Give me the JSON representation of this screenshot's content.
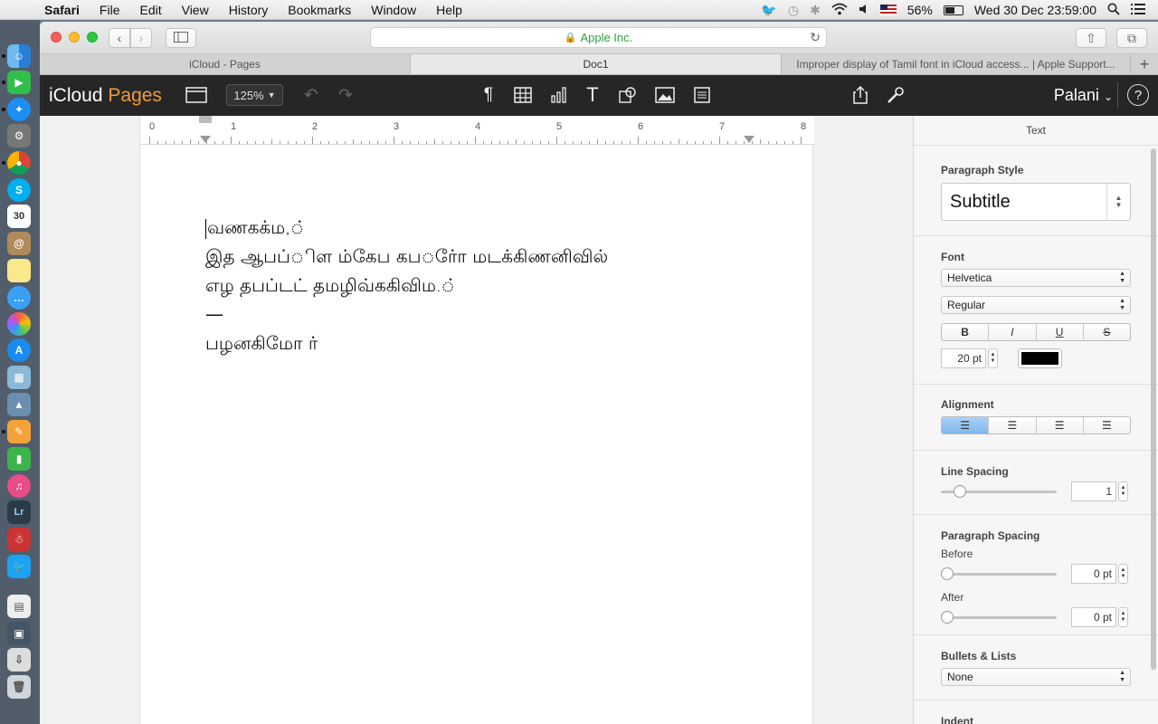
{
  "menubar": {
    "app": "Safari",
    "items": [
      "File",
      "Edit",
      "View",
      "History",
      "Bookmarks",
      "Window",
      "Help"
    ],
    "battery": "56%",
    "clock": "Wed 30 Dec  23:59:00",
    "battery_level": 0.56
  },
  "browser": {
    "address": "Apple Inc.",
    "tabs": [
      {
        "label": "iCloud - Pages"
      },
      {
        "label": "Doc1"
      },
      {
        "label": "Improper display of Tamil font in iCloud access... | Apple Support..."
      }
    ],
    "new_tab": "+"
  },
  "pages": {
    "brand_prefix": "iCloud",
    "brand_name": "Pages",
    "zoom": "125%",
    "user": "Palani",
    "help": "?"
  },
  "ruler": {
    "numbers": [
      "0",
      "1",
      "2",
      "3",
      "4",
      "5",
      "6",
      "7",
      "8"
    ]
  },
  "document": {
    "lines": [
      "வணகக்ம,்",
      "இத ஆபப்ிள ம்கேப கபர்ோ மடக்கிணனிவில்",
      "எழ தபப்டட் தமழிவ்ககிவிம.்",
      "—",
      "பழனகிமோ ர்"
    ]
  },
  "inspector": {
    "title": "Text",
    "paragraph_style_label": "Paragraph Style",
    "paragraph_style": "Subtitle",
    "font_label": "Font",
    "font": "Helvetica",
    "font_weight": "Regular",
    "format_buttons": [
      "B",
      "I",
      "U",
      "S"
    ],
    "font_size": "20 pt",
    "text_color": "#000000",
    "alignment_label": "Alignment",
    "alignment_selected": "left",
    "line_spacing_label": "Line Spacing",
    "line_spacing": "1",
    "line_spacing_slider": 0.12,
    "paragraph_spacing_label": "Paragraph Spacing",
    "before_label": "Before",
    "before_value": "0 pt",
    "before_slider": 0,
    "after_label": "After",
    "after_value": "0 pt",
    "after_slider": 0,
    "bullets_label": "Bullets & Lists",
    "bullets_value": "None",
    "indent_label": "Indent"
  },
  "colors": {
    "pages_accent": "#ef9a3b",
    "secure_green": "#2ba33d",
    "alignment_selected": "#7fb7ec"
  }
}
